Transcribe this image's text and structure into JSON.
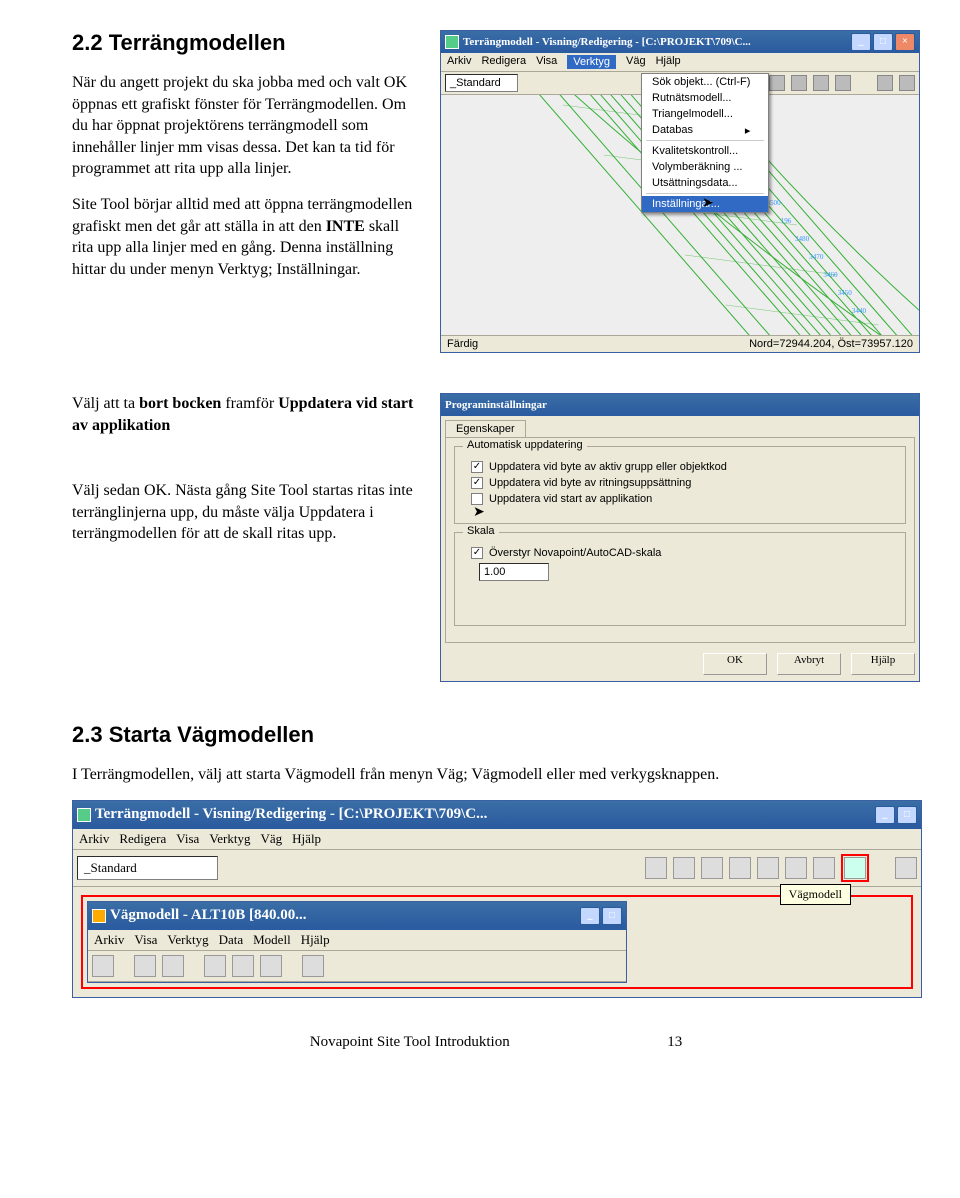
{
  "section1": {
    "heading": "2.2 Terrängmodellen",
    "p1": "När du angett projekt du ska jobba med och valt OK öppnas ett grafiskt fönster för Terrängmodellen. Om du har öppnat projektörens terrängmodell som innehåller linjer mm visas dessa. Det kan ta tid för programmet att rita upp alla linjer.",
    "p2a": "Site Tool börjar alltid med att öppna terrängmodellen grafiskt men det går att ställa in att den ",
    "p2b": " skall rita upp alla linjer med en gång. Denna inställning hittar du under menyn Verktyg; Inställningar.",
    "inte": "INTE"
  },
  "shot1": {
    "title": "Terrängmodell - Visning/Redigering - [C:\\PROJEKT\\709\\C...",
    "menus": [
      "Arkiv",
      "Redigera",
      "Visa",
      "Verktyg",
      "Väg",
      "Hjälp"
    ],
    "active_menu_index": 3,
    "dropdown": [
      "Sök objekt... (Ctrl-F)",
      "Rutnätsmodell...",
      "Triangelmodell...",
      "Databas",
      "Kvalitetskontroll...",
      "Volymberäkning ...",
      "Utsättningsdata...",
      "Inställningar..."
    ],
    "toolbar_select": "_Standard",
    "status_left": "Färdig",
    "status_right": "Nord=72944.204, Öst=73957.120"
  },
  "section2": {
    "p1a": "Välj att ta ",
    "p1b": "bort bocken",
    "p1c": " framför ",
    "p1d": "Uppdatera vid start av applikation",
    "p2": "Välj sedan OK. Nästa gång Site Tool startas ritas inte terränglinjerna upp, du måste välja Uppdatera i terrängmodellen för att de skall ritas upp."
  },
  "shot2": {
    "title": "Programinställningar",
    "tab": "Egenskaper",
    "group1": "Automatisk uppdatering",
    "cb1": "Uppdatera vid byte av aktiv grupp eller objektkod",
    "cb2": "Uppdatera vid byte av ritningsuppsättning",
    "cb3": "Uppdatera vid start av applikation",
    "group2": "Skala",
    "cb4": "Överstyr Novapoint/AutoCAD-skala",
    "scale_value": "1.00",
    "ok": "OK",
    "avbryt": "Avbryt",
    "hjalp": "Hjälp"
  },
  "section3": {
    "heading": "2.3 Starta Vägmodellen",
    "p1": "I Terrängmodellen, välj att starta Vägmodell från menyn Väg; Vägmodell eller med verkygsknappen."
  },
  "shot3": {
    "title": "Terrängmodell - Visning/Redigering - [C:\\PROJEKT\\709\\C...",
    "menus": [
      "Arkiv",
      "Redigera",
      "Visa",
      "Verktyg",
      "Väg",
      "Hjälp"
    ],
    "toolbar_select": "_Standard",
    "tooltip": "Vägmodell"
  },
  "shot4": {
    "title": "Vägmodell - ALT10B  [840.00...",
    "menus": [
      "Arkiv",
      "Visa",
      "Verktyg",
      "Data",
      "Modell",
      "Hjälp"
    ]
  },
  "footer": {
    "left": "Novapoint Site Tool Introduktion",
    "page": "13"
  }
}
